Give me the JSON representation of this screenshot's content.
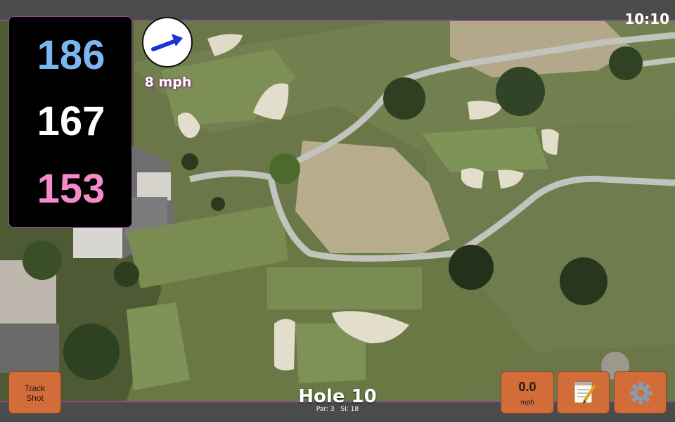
{
  "status": {
    "time": "10:10"
  },
  "distances": {
    "back": "186",
    "middle": "167",
    "front": "153",
    "colors": {
      "back": "#7ab7f0",
      "middle": "#ffffff",
      "front": "#f58bc8"
    }
  },
  "wind": {
    "speed_label": "8 mph",
    "arrow_color": "#1a33d6",
    "icon": "wind-direction-arrow"
  },
  "hole": {
    "title": "Hole 10",
    "par_label": "Par: 3",
    "si_label": "SI: 18"
  },
  "buttons": {
    "track_shot_line1": "Track",
    "track_shot_line2": "Shot",
    "speed_value": "0.0",
    "speed_unit": "mph",
    "notes_icon": "notepad-icon",
    "settings_icon": "gear-icon",
    "accent": "#d26d3a"
  }
}
